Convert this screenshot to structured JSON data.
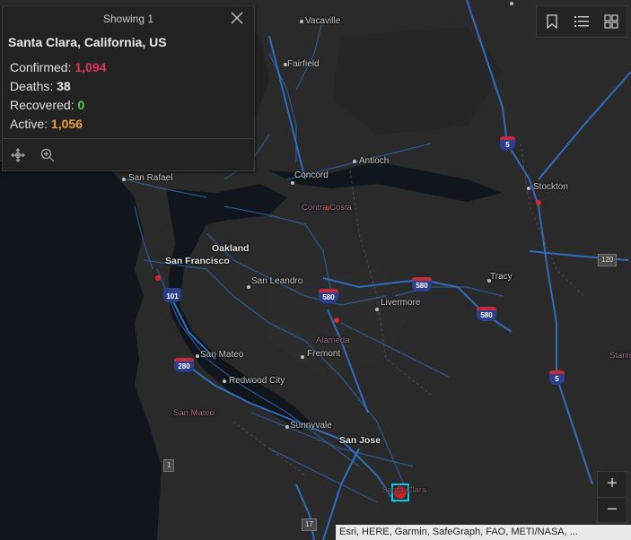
{
  "popup": {
    "header": "Showing 1",
    "close_icon": "close-icon",
    "title": "Santa Clara, California, US",
    "rows": [
      {
        "label": "Confirmed:",
        "value": "1,094",
        "color": "#e0345b"
      },
      {
        "label": "Deaths:",
        "value": "38",
        "color": "#e8e8e8"
      },
      {
        "label": "Recovered:",
        "value": "0",
        "color": "#4cd13c"
      },
      {
        "label": "Active:",
        "value": "1,056",
        "color": "#f39c35"
      }
    ],
    "actions": [
      "pan-icon",
      "zoom-to-icon"
    ]
  },
  "toolbar": [
    "bookmark-icon",
    "legend-list-icon",
    "basemap-gallery-icon"
  ],
  "zoom": {
    "in": "+",
    "out": "−"
  },
  "map_labels": {
    "vacaville": "Vacaville",
    "fairfield": "Fairfield",
    "antioch": "Antioch",
    "concord": "Concord",
    "san_rafael": "San Rafael",
    "contra_costa": "Contra Costa",
    "stockton": "Stockton",
    "oakland": "Oakland",
    "san_francisco": "San Francisco",
    "san_leandro": "San Leandro",
    "tracy": "Tracy",
    "livermore": "Livermore",
    "alameda": "Alameda",
    "fremont": "Fremont",
    "san_mateo_city": "San Mateo",
    "redwood_city": "Redwood City",
    "san_mateo_county": "San Mateo",
    "sunnyvale": "Sunnyvale",
    "san_jose": "San Jose",
    "santa_clara": "Santa Clara",
    "stanislaus": "Stanis"
  },
  "shields": {
    "i5_north": "5",
    "i5_south": "5",
    "i580_a": "580",
    "i580_b": "580",
    "i580_c": "580",
    "i280": "280",
    "us101": "101",
    "r120": "120",
    "r1": "1",
    "r17": "17"
  },
  "attribution": "Esri, HERE, Garmin, SafeGraph, FAO, METI/NASA, ..."
}
